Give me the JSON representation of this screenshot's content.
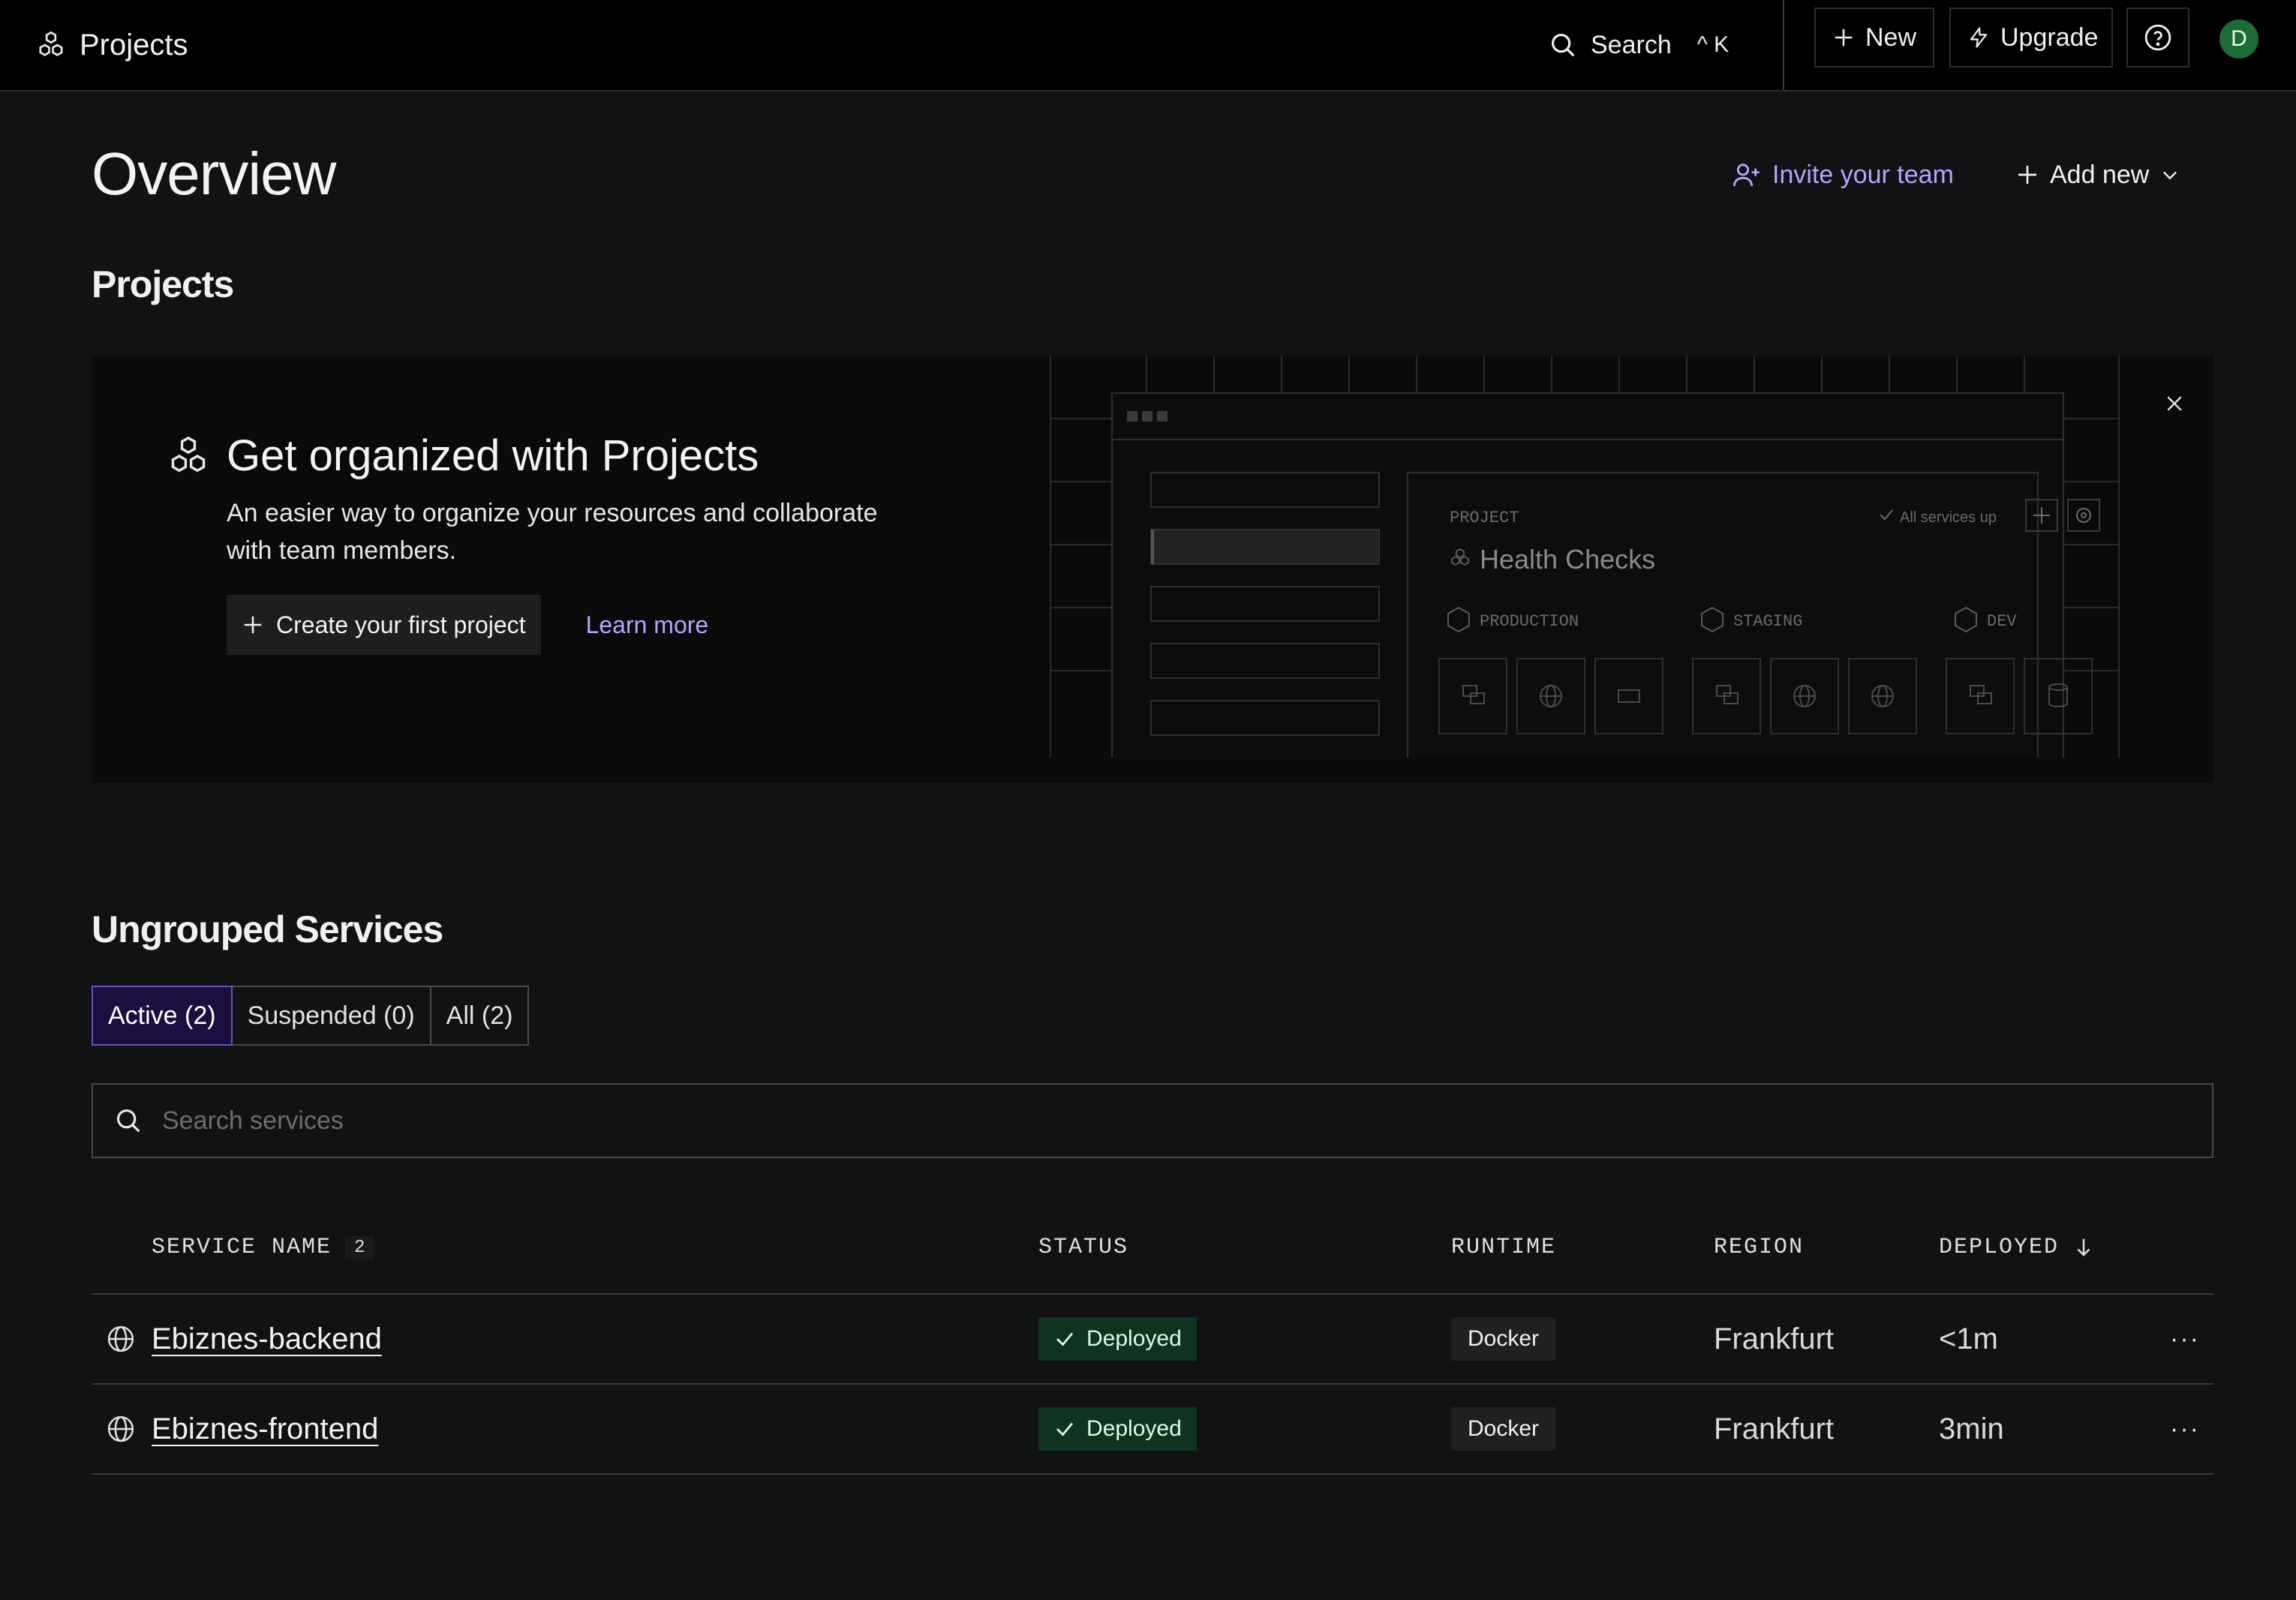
{
  "topbar": {
    "app_title": "Projects",
    "search_label": "Search",
    "search_shortcut": "^ K",
    "new_label": "New",
    "upgrade_label": "Upgrade",
    "avatar_initial": "D"
  },
  "page": {
    "title": "Overview",
    "invite_label": "Invite your team",
    "add_new_label": "Add new"
  },
  "projects": {
    "section_title": "Projects",
    "banner": {
      "title": "Get organized with Projects",
      "description": "An easier way to organize your resources and collaborate with team members.",
      "create_label": "Create your first project",
      "learn_more_label": "Learn more",
      "illustration": {
        "project_label": "PROJECT",
        "project_name": "Health Checks",
        "status_text": "All services up",
        "environments": [
          "PRODUCTION",
          "STAGING",
          "DEV"
        ]
      }
    }
  },
  "ungrouped": {
    "section_title": "Ungrouped Services",
    "filters": [
      {
        "label": "Active (2)",
        "active": true
      },
      {
        "label": "Suspended (0)",
        "active": false
      },
      {
        "label": "All (2)",
        "active": false
      }
    ],
    "search_placeholder": "Search services",
    "columns": {
      "service_name": "SERVICE NAME",
      "service_count": "2",
      "status": "STATUS",
      "runtime": "RUNTIME",
      "region": "REGION",
      "deployed": "DEPLOYED"
    },
    "rows": [
      {
        "name": "Ebiznes-backend",
        "status": "Deployed",
        "runtime": "Docker",
        "region": "Frankfurt",
        "deployed": "<1m",
        "menu": "···"
      },
      {
        "name": "Ebiznes-frontend",
        "status": "Deployed",
        "runtime": "Docker",
        "region": "Frankfurt",
        "deployed": "3min",
        "menu": "···"
      }
    ]
  },
  "colors": {
    "background": "#111213",
    "topbar": "#000000",
    "accent_purple": "#b9a2ff",
    "active_tab_bg": "#1c0f3f",
    "deployed_badge_bg": "#0f3320",
    "avatar_bg": "#1e6b3a"
  },
  "icons": {
    "brand": "projects-hexagons-icon",
    "search": "search-icon",
    "new": "plus-icon",
    "upgrade": "lightning-icon",
    "help": "help-circle-icon",
    "invite": "user-plus-icon",
    "add_new_chevron": "chevron-down-icon",
    "close": "close-icon",
    "service": "globe-icon",
    "status": "check-icon",
    "sort": "arrow-down-icon"
  }
}
